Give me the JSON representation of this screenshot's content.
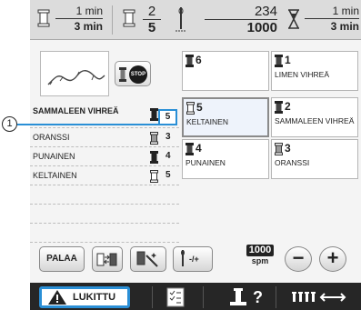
{
  "callout": {
    "label": "1"
  },
  "time_bar": {
    "seg1": {
      "top": "1 min",
      "bottom": "3 min"
    },
    "seg2": {
      "top": "2",
      "bottom": "5"
    },
    "seg3": {
      "top": "234",
      "bottom": "1000"
    },
    "seg4": {
      "top": "1 min",
      "bottom": "3 min"
    }
  },
  "stop_label": "STOP",
  "thread_list": [
    {
      "name": "SAMMALEEN VIHREÄ",
      "number": "5",
      "selected": true,
      "spool": "dark"
    },
    {
      "name": "ORANSSI",
      "number": "3",
      "selected": false,
      "spool": "light"
    },
    {
      "name": "PUNAINEN",
      "number": "4",
      "selected": false,
      "spool": "dark"
    },
    {
      "name": "KELTAINEN",
      "number": "5",
      "selected": false,
      "spool": "outline"
    }
  ],
  "spool_grid": [
    {
      "number": "6",
      "name": ""
    },
    {
      "number": "1",
      "name": "LIMEN VIHREÄ"
    },
    {
      "number": "5",
      "name": "KELTAINEN"
    },
    {
      "number": "2",
      "name": "SAMMALEEN VIHREÄ"
    },
    {
      "number": "4",
      "name": "PUNAINEN"
    },
    {
      "number": "3",
      "name": "ORANSSI"
    }
  ],
  "controls": {
    "back_label": "PALAA",
    "needle_label": "-/+",
    "speed_value": "1000",
    "speed_unit": "spm",
    "minus_label": "−",
    "plus_label": "+"
  },
  "bottom_bar": {
    "lock_label": "LUKITTU",
    "help_symbol": "?"
  },
  "colors": {
    "accent": "#2a8fd6",
    "bottom_bar": "#262626"
  }
}
